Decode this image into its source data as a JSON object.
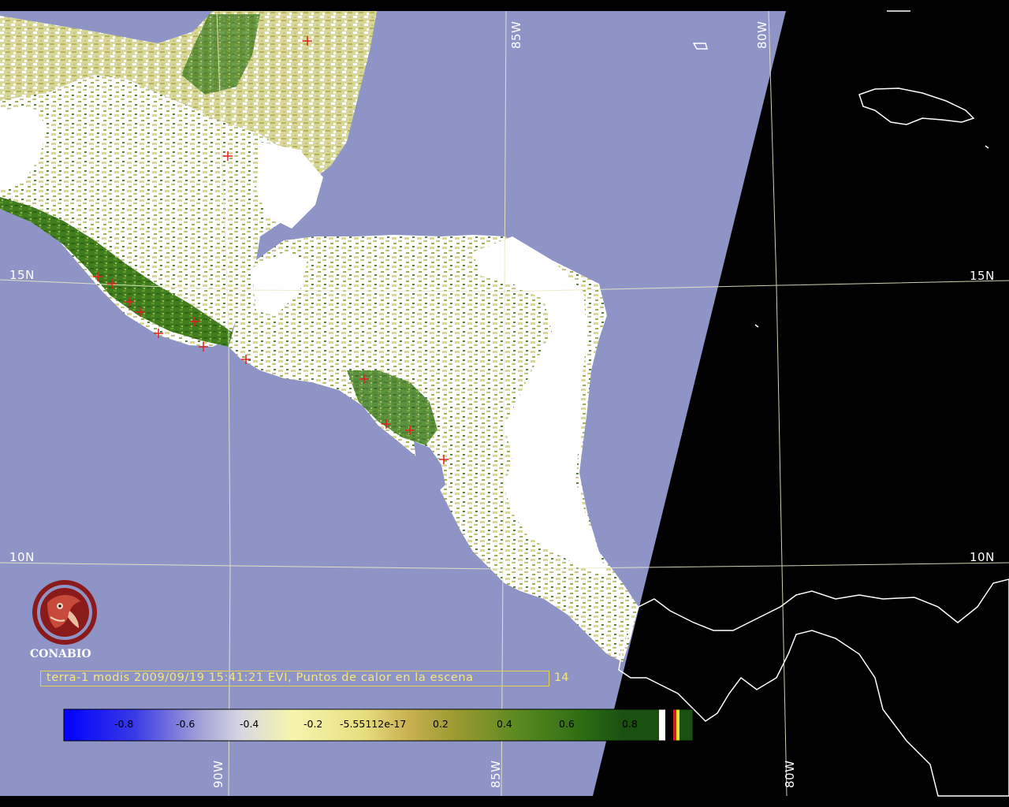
{
  "colors": {
    "ocean": "#8e95c6",
    "night": "#000000",
    "grid": "#e8e8c8",
    "coast": "#ffffff",
    "cloud": "#ffffff",
    "hotspot": "#e02020",
    "caption": "#f5e87a",
    "logo": "#8b1a1a"
  },
  "grid_labels": {
    "lat_15_left": "15N",
    "lat_15_right": "15N",
    "lat_10_left": "10N",
    "lat_10_right": "10N",
    "lon_85_top": "85W",
    "lon_80_top": "80W",
    "lon_90_bottom": "90W",
    "lon_85_bottom": "85W",
    "lon_80_bottom": "80W"
  },
  "logo": {
    "text": "CONABIO",
    "icon": "conabio-macaw-logo-icon"
  },
  "caption": {
    "text": "terra-1 modis 2009/09/19 15:41:21 EVI, Puntos de calor en la escena",
    "count": "14"
  },
  "colorbar": {
    "ticks": [
      "-0.8",
      "-0.6",
      "-0.4",
      "-0.2",
      "-5.55112e-17",
      "0.2",
      "0.4",
      "0.6",
      "0.8"
    ]
  },
  "hotspot_count": 14
}
